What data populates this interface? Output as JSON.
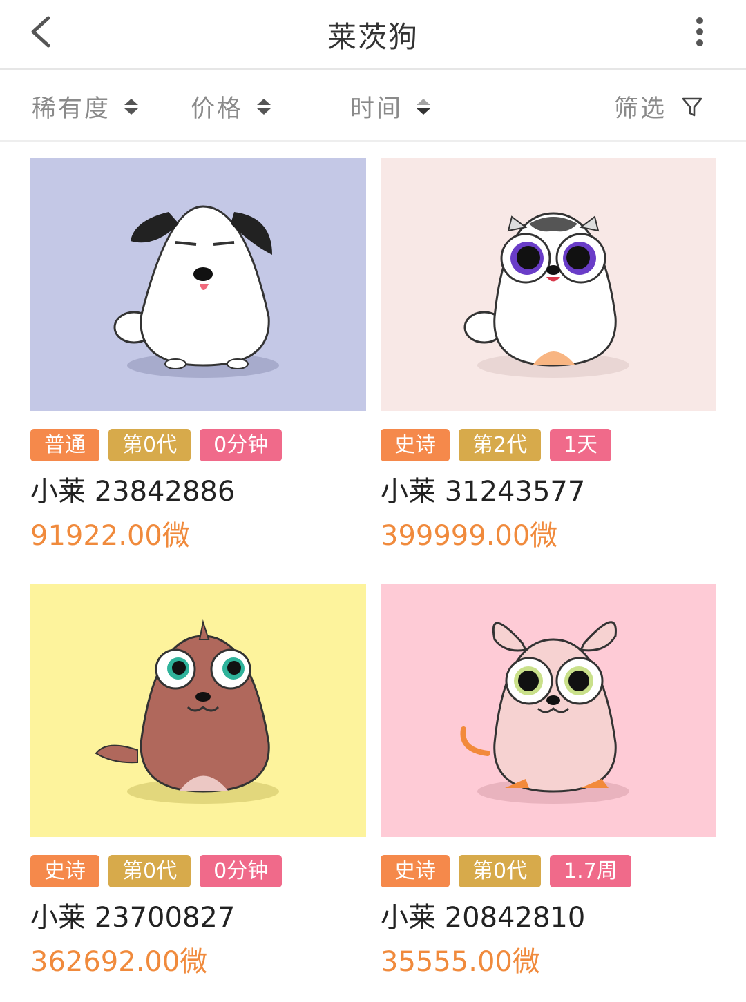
{
  "header": {
    "title": "莱茨狗"
  },
  "sort": {
    "rarity": "稀有度",
    "price": "价格",
    "time": "时间",
    "filter": "筛选"
  },
  "colors": {
    "accent_price": "#f08a3c",
    "tag_rarity": "#f5894b",
    "tag_generation": "#d7aa4b",
    "tag_time": "#f06a8a"
  },
  "cards": [
    {
      "bg": "#c4c8e6",
      "rarity": "普通",
      "generation": "第0代",
      "time": "0分钟",
      "name": "小莱 23842886",
      "price": "91922.00微"
    },
    {
      "bg": "#f8e8e6",
      "rarity": "史诗",
      "generation": "第2代",
      "time": "1天",
      "name": "小莱 31243577",
      "price": "399999.00微"
    },
    {
      "bg": "#fdf39c",
      "rarity": "史诗",
      "generation": "第0代",
      "time": "0分钟",
      "name": "小莱 23700827",
      "price": "362692.00微"
    },
    {
      "bg": "#fecbd6",
      "rarity": "史诗",
      "generation": "第0代",
      "time": "1.7周",
      "name": "小莱 20842810",
      "price": "35555.00微"
    }
  ]
}
